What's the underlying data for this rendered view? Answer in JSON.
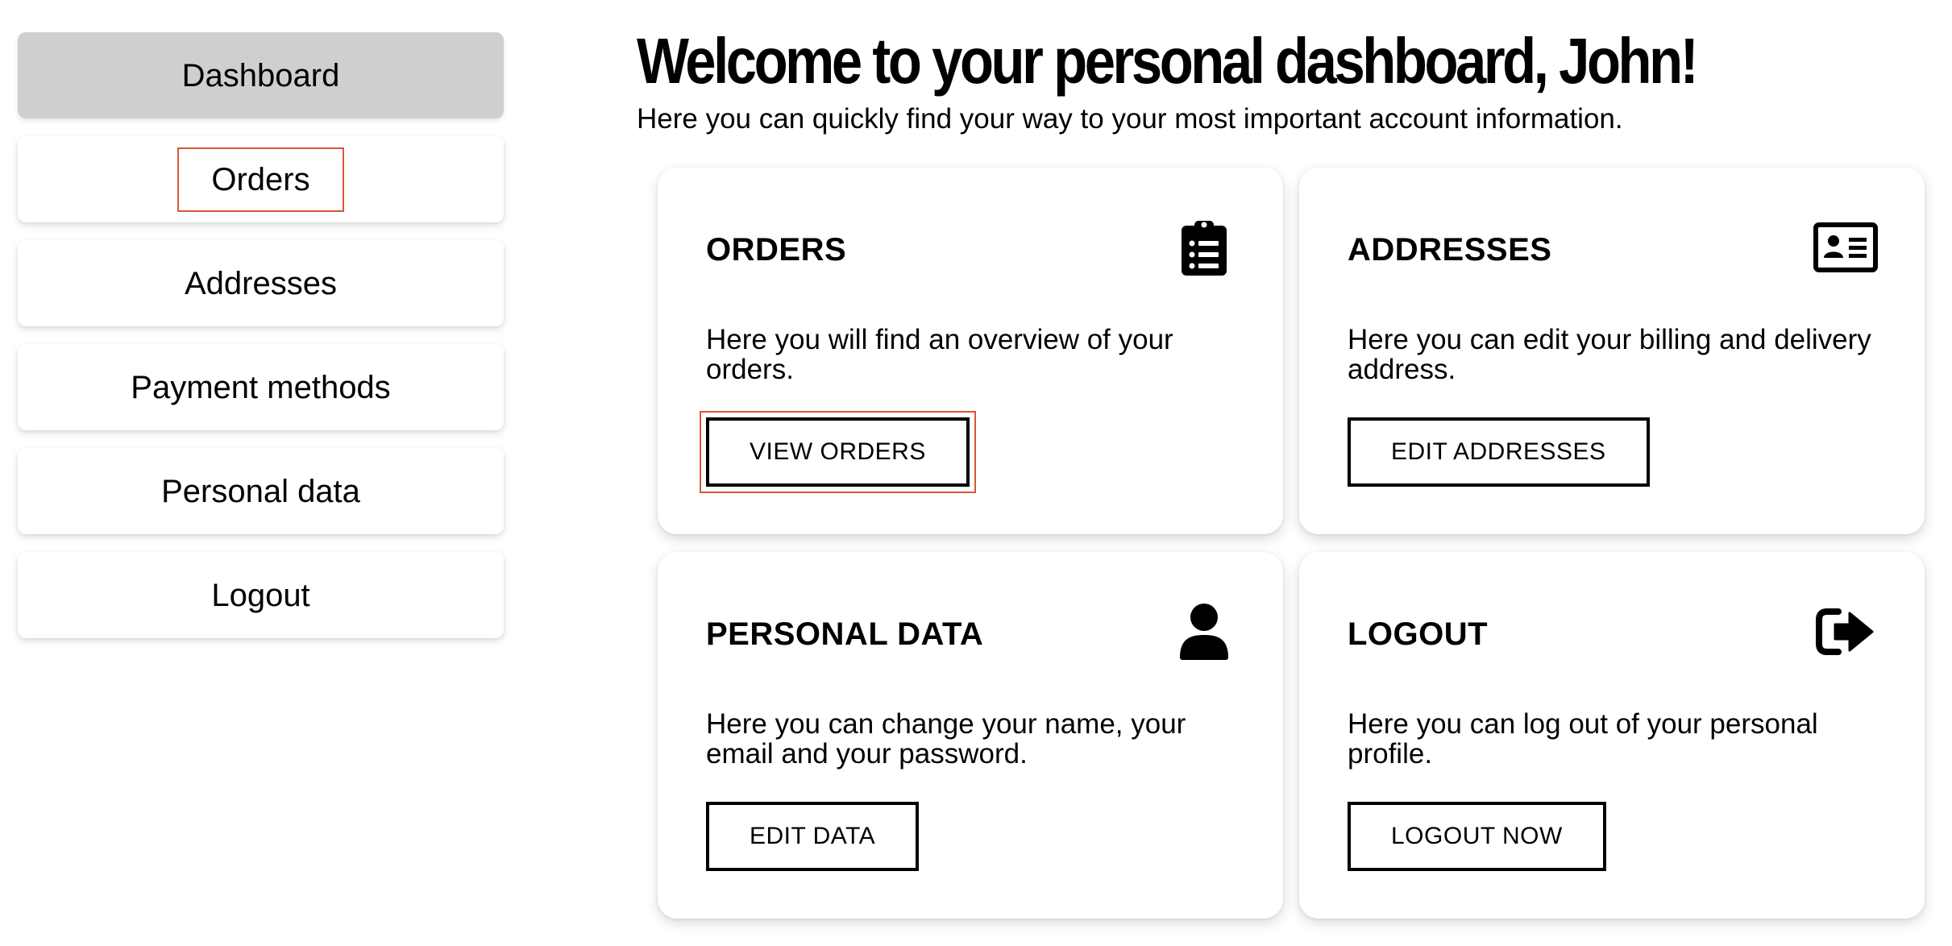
{
  "sidebar": {
    "items": [
      {
        "label": "Dashboard"
      },
      {
        "label": "Orders"
      },
      {
        "label": "Addresses"
      },
      {
        "label": "Payment methods"
      },
      {
        "label": "Personal data"
      },
      {
        "label": "Logout"
      }
    ]
  },
  "header": {
    "title": "Welcome to your personal dashboard, John!",
    "subtitle": "Here you can quickly find your way to your most important account information."
  },
  "cards": [
    {
      "title": "ORDERS",
      "icon": "clipboard-list-icon",
      "description": "Here you will find an overview of your orders.",
      "button": "VIEW ORDERS"
    },
    {
      "title": "ADDRESSES",
      "icon": "address-card-icon",
      "description": "Here you can edit your billing and delivery address.",
      "button": "EDIT ADDRESSES"
    },
    {
      "title": "PERSONAL DATA",
      "icon": "user-icon",
      "description": "Here you can change your name, your email and your password.",
      "button": "EDIT DATA"
    },
    {
      "title": "LOGOUT",
      "icon": "sign-out-icon",
      "description": "Here you can log out of your personal profile.",
      "button": "LOGOUT NOW"
    }
  ],
  "colors": {
    "active_nav_bg": "#cfcfcf",
    "focus_outline": "#d9553a",
    "text": "#000000",
    "background": "#ffffff"
  }
}
